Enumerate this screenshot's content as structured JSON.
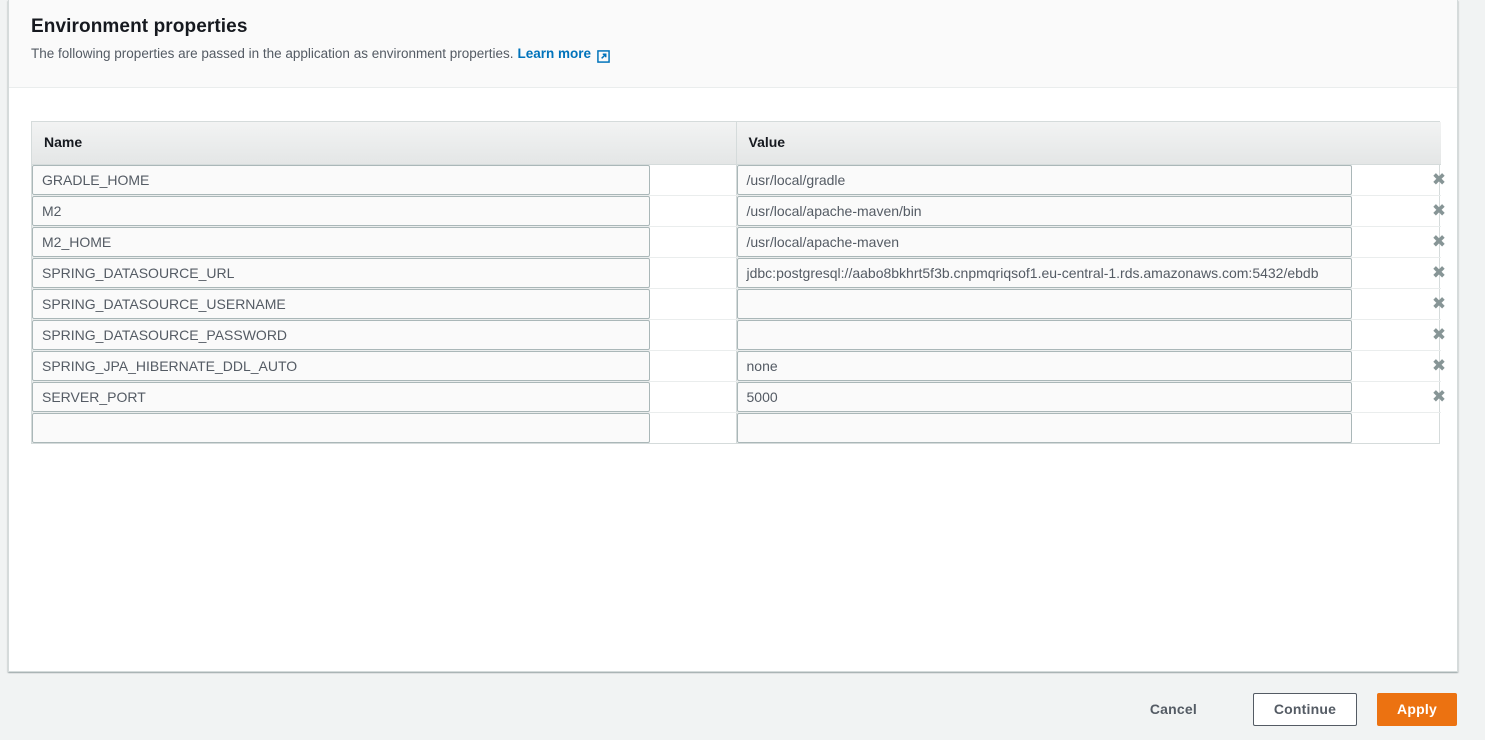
{
  "header": {
    "title": "Environment properties",
    "description": "The following properties are passed in the application as environment properties.",
    "learn_more_label": "Learn more",
    "learn_more_icon": "external-link-icon"
  },
  "table": {
    "columns": {
      "name": "Name",
      "value": "Value"
    },
    "remove_icon": "close-x-icon",
    "rows": [
      {
        "name": "GRADLE_HOME",
        "value": "/usr/local/gradle",
        "removable": true
      },
      {
        "name": "M2",
        "value": "/usr/local/apache-maven/bin",
        "removable": true
      },
      {
        "name": "M2_HOME",
        "value": "/usr/local/apache-maven",
        "removable": true
      },
      {
        "name": "SPRING_DATASOURCE_URL",
        "value": "jdbc:postgresql://aabo8bkhrt5f3b.cnpmqriqsof1.eu-central-1.rds.amazonaws.com:5432/ebdb",
        "removable": true
      },
      {
        "name": "SPRING_DATASOURCE_USERNAME",
        "value": "",
        "removable": true
      },
      {
        "name": "SPRING_DATASOURCE_PASSWORD",
        "value": "",
        "removable": true
      },
      {
        "name": "SPRING_JPA_HIBERNATE_DDL_AUTO",
        "value": "none",
        "removable": true
      },
      {
        "name": "SERVER_PORT",
        "value": "5000",
        "removable": true
      },
      {
        "name": "",
        "value": "",
        "removable": false
      }
    ]
  },
  "footer": {
    "cancel_label": "Cancel",
    "continue_label": "Continue",
    "apply_label": "Apply"
  },
  "colors": {
    "accent_orange": "#ec7211",
    "link_blue": "#0073bb",
    "text_dark": "#16191f",
    "text_muted": "#545b64",
    "page_bg": "#f1f3f3",
    "border": "#d5dbdb"
  }
}
